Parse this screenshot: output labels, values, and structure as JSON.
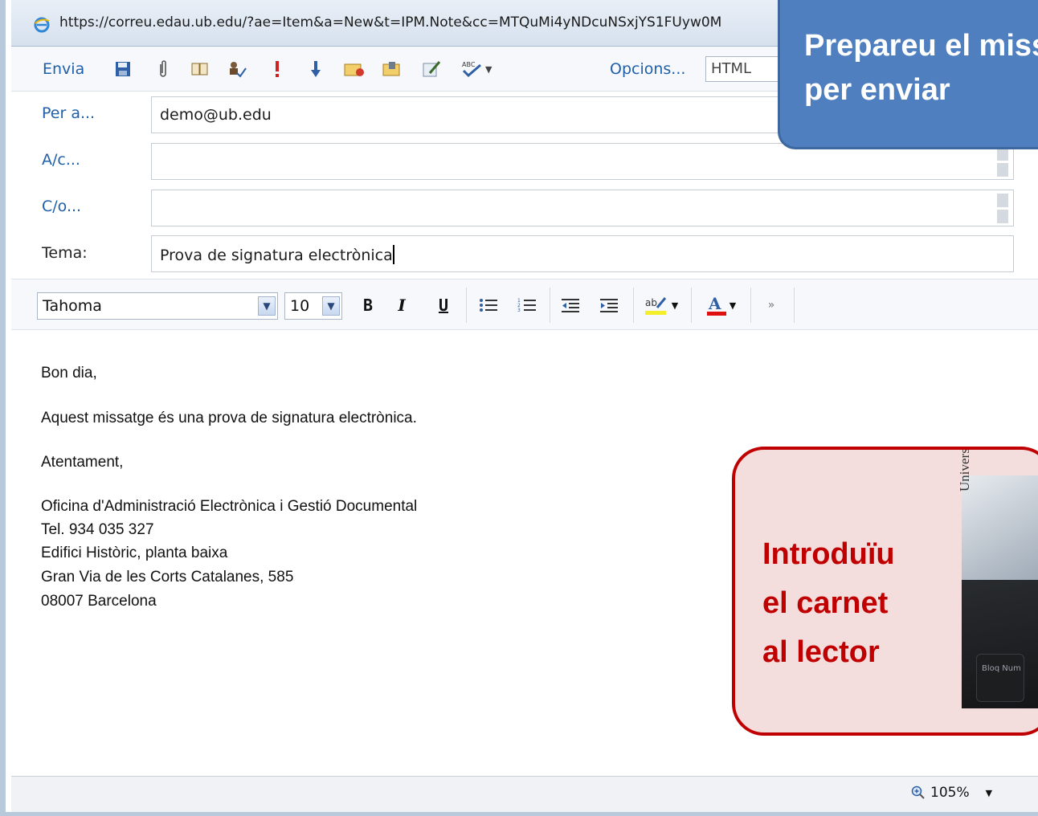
{
  "browser": {
    "url": "https://correu.edau.ub.edu/?ae=Item&a=New&t=IPM.Note&cc=MTQuMi4yNDcuNSxjYS1FUyw0M"
  },
  "toolbar": {
    "send_label": "Envia",
    "options_label": "Opcions...",
    "format_value": "HTML"
  },
  "headers": {
    "to_label": "Per a...",
    "to_value": "demo@ub.edu",
    "cc_label": "A/c...",
    "cc_value": "",
    "bcc_label": "C/o...",
    "bcc_value": "",
    "subject_label": "Tema:",
    "subject_value": "Prova de signatura electrònica"
  },
  "format_bar": {
    "font": "Tahoma",
    "size": "10",
    "bold": "B",
    "italic": "I",
    "underline": "U"
  },
  "body": {
    "lines": [
      "Bon dia,",
      "Aquest missatge és una prova de signatura electrònica.",
      "Atentament,",
      "Oficina d'Administració Electrònica i Gestió Documental",
      "Tel. 934 035 327",
      "Edifici Històric, planta baixa",
      "Gran Via de les Corts Catalanes, 585",
      "08007 Barcelona"
    ]
  },
  "status": {
    "zoom": "105%"
  },
  "callouts": {
    "blue_line1": "Prepareu el missatge",
    "blue_line2": "per enviar",
    "red_line1": "Introduïu",
    "red_line2": "el carnet",
    "red_line3": "al lector",
    "card_text": "Universitat de Barcelona",
    "key_text": "Bloq Num"
  },
  "colors": {
    "link": "#1f5fa8",
    "callout_blue": "#4f7fbf",
    "callout_red_border": "#c00000",
    "callout_red_fill": "#f3dddd"
  }
}
